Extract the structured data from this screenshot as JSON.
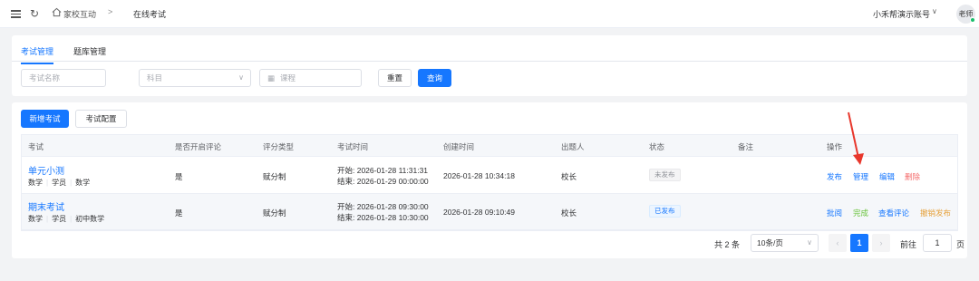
{
  "header": {
    "breadcrumb_root": "家校互动",
    "breadcrumb_sep": ">",
    "breadcrumb_current": "在线考试",
    "account": "小禾帮演示账号",
    "avatar": "老师"
  },
  "tabs": [
    "考试管理",
    "题库管理"
  ],
  "filters": {
    "name_placeholder": "考试名称",
    "subject_placeholder": "科目",
    "course_placeholder": "课程",
    "reset_label": "重置",
    "search_label": "查询"
  },
  "toolbar": {
    "add_label": "新增考试",
    "config_label": "考试配置"
  },
  "table": {
    "columns": [
      "考试",
      "是否开启评论",
      "评分类型",
      "考试时间",
      "创建时间",
      "出题人",
      "状态",
      "备注",
      "操作"
    ],
    "rows": [
      {
        "name": "单元小测",
        "tags": [
          "数学",
          "学员",
          "数学"
        ],
        "comment": "是",
        "score_type": "赋分制",
        "start": "开始: 2026-01-28 11:31:31",
        "end": "结束: 2026-01-29 00:00:00",
        "created": "2026-01-28 10:34:18",
        "author": "校长",
        "status": "未发布",
        "remark": "",
        "actions": [
          "发布",
          "管理",
          "编辑",
          "删除"
        ]
      },
      {
        "name": "期末考试",
        "tags": [
          "数学",
          "学员",
          "初中数学"
        ],
        "comment": "是",
        "score_type": "赋分制",
        "start": "开始: 2026-01-28 09:30:00",
        "end": "结束: 2026-01-28 10:30:00",
        "created": "2026-01-28 09:10:49",
        "author": "校长",
        "status": "已发布",
        "remark": "",
        "actions": [
          "批阅",
          "完成",
          "查看评论",
          "撤销发布"
        ]
      }
    ]
  },
  "pagination": {
    "total": "共 2 条",
    "page_size": "10条/页",
    "current_page": "1",
    "goto_label": "前往",
    "goto_value": "1",
    "page_unit": "页"
  },
  "colors": {
    "primary": "#1677ff",
    "danger": "#f56c6c",
    "success": "#67c23a",
    "warning": "#e6a23c",
    "annotation_arrow": "#e8372c"
  }
}
